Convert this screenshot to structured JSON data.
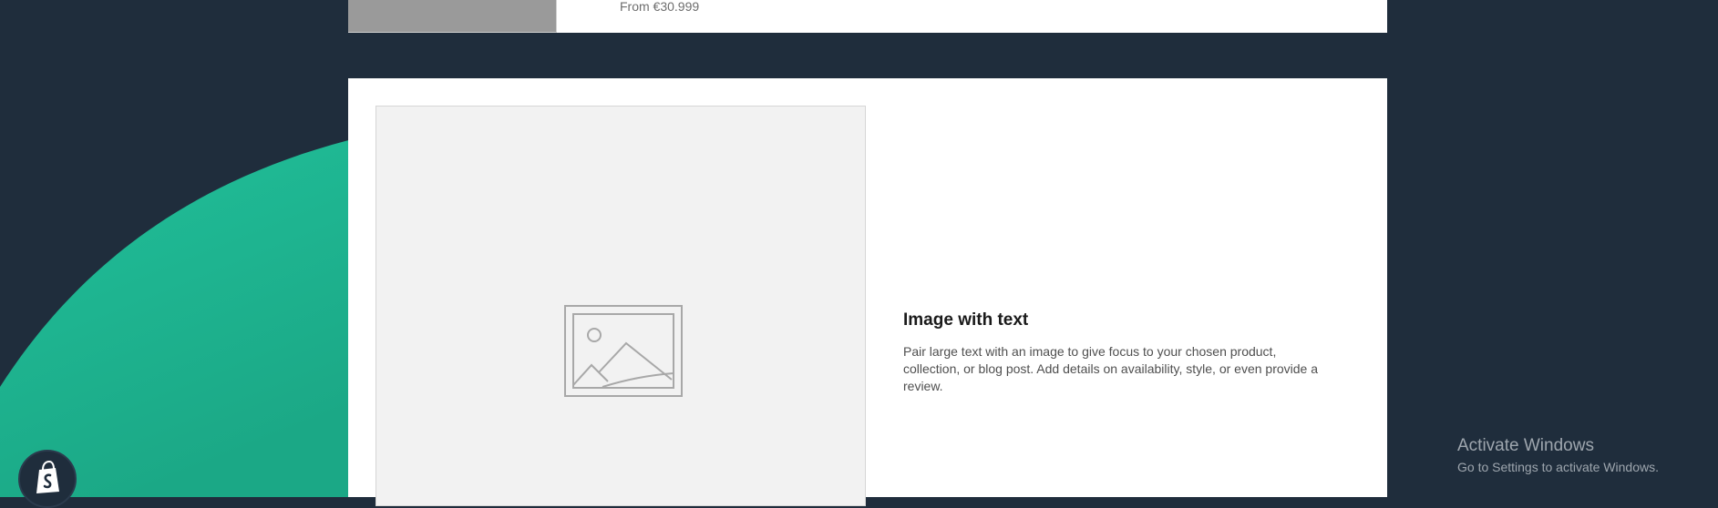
{
  "colors": {
    "page_background": "#1f2d3c",
    "accent_wave": "#1eb895",
    "card_background": "#ffffff",
    "placeholder_background": "#f2f2f2"
  },
  "product": {
    "price": "From €30.999"
  },
  "image_with_text": {
    "placeholder_icon": "image-placeholder-icon",
    "heading": "Image with text",
    "body": "Pair large text with an image to give focus to your chosen product, collection, or blog post. Add details on availability, style, or even provide a review."
  },
  "windows_watermark": {
    "title": "Activate Windows",
    "subtitle": "Go to Settings to activate Windows."
  },
  "shopify": {
    "icon": "shopify-bag-icon"
  }
}
